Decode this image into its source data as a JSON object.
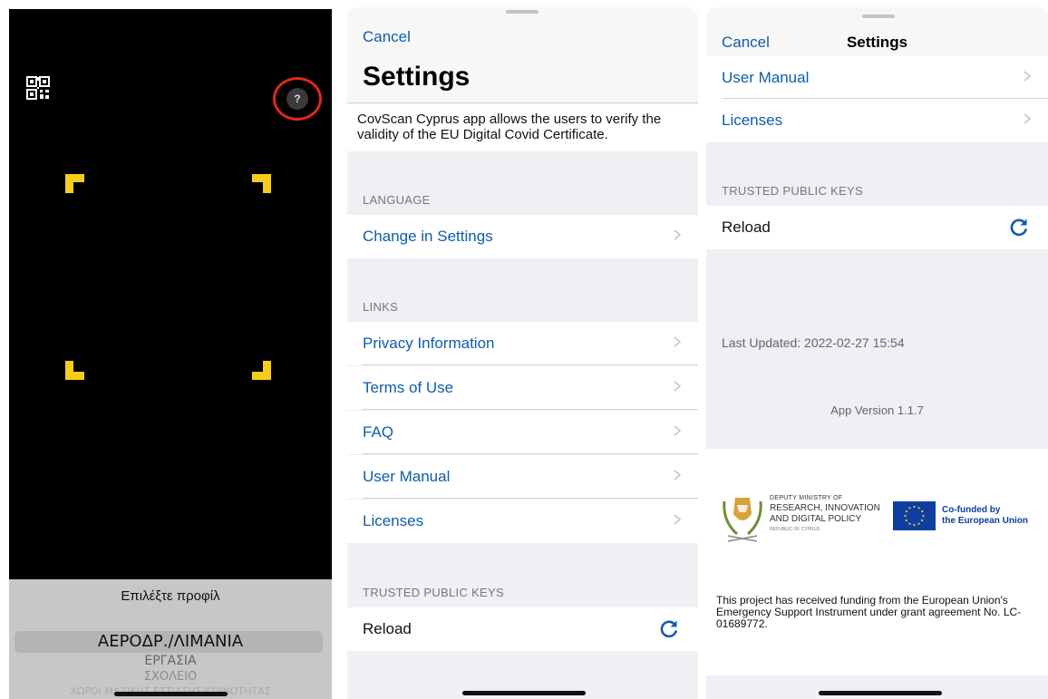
{
  "colors": {
    "link_blue": "#0f5cab",
    "scan_corner_yellow": "#f7cd1b",
    "highlight_ring_red": "#e0281e",
    "eu_blue": "#0e3fa0"
  },
  "scanner": {
    "qr_icon": "qr-code-icon",
    "help_label": "?",
    "profile_title": "Επιλέξτε προφίλ",
    "profile_options": [
      "ΑΕΡΟΔΡ./ΛΙΜΑΝΙΑ",
      "ΕΡΓΑΣΙΑ",
      "ΣΧΟΛΕΙΟ",
      "ΧΩΡΟΙ ΜΑΖΙΚΗΣ ΕΣΤΙΑΣΗΣ/ΚΟΙΝΟΤΗΤΑΣ"
    ],
    "selected_profile": "ΑΕΡΟΔΡ./ΛΙΜΑΝΙΑ"
  },
  "settings_full": {
    "cancel_label": "Cancel",
    "title": "Settings",
    "description": "CovScan Cyprus app allows the users to verify the validity of the EU Digital Covid Certificate.",
    "language_header": "LANGUAGE",
    "language_row": "Change in Settings",
    "links_header": "LINKS",
    "links": [
      "Privacy Information",
      "Terms of Use",
      "FAQ",
      "User Manual",
      "Licenses"
    ],
    "keys_header": "TRUSTED PUBLIC KEYS",
    "reload_label": "Reload"
  },
  "settings_scrolled": {
    "cancel_label": "Cancel",
    "title": "Settings",
    "links": [
      "User Manual",
      "Licenses"
    ],
    "keys_header": "TRUSTED PUBLIC KEYS",
    "reload_label": "Reload",
    "last_updated": "Last Updated: 2022-02-27 15:54",
    "app_version": "App Version 1.1.7",
    "ministry_logo": {
      "line1": "DEPUTY MINISTRY OF",
      "line2": "RESEARCH, INNOVATION",
      "line3": "AND DIGITAL POLICY",
      "line4": "REPUBLIC OF CYPRUS"
    },
    "eu_logo": {
      "line1": "Co-funded by",
      "line2": "the European Union"
    },
    "funding_note": "This project has received funding from the European Union's Emergency Support Instrument under grant agreement No. LC-01689772."
  }
}
